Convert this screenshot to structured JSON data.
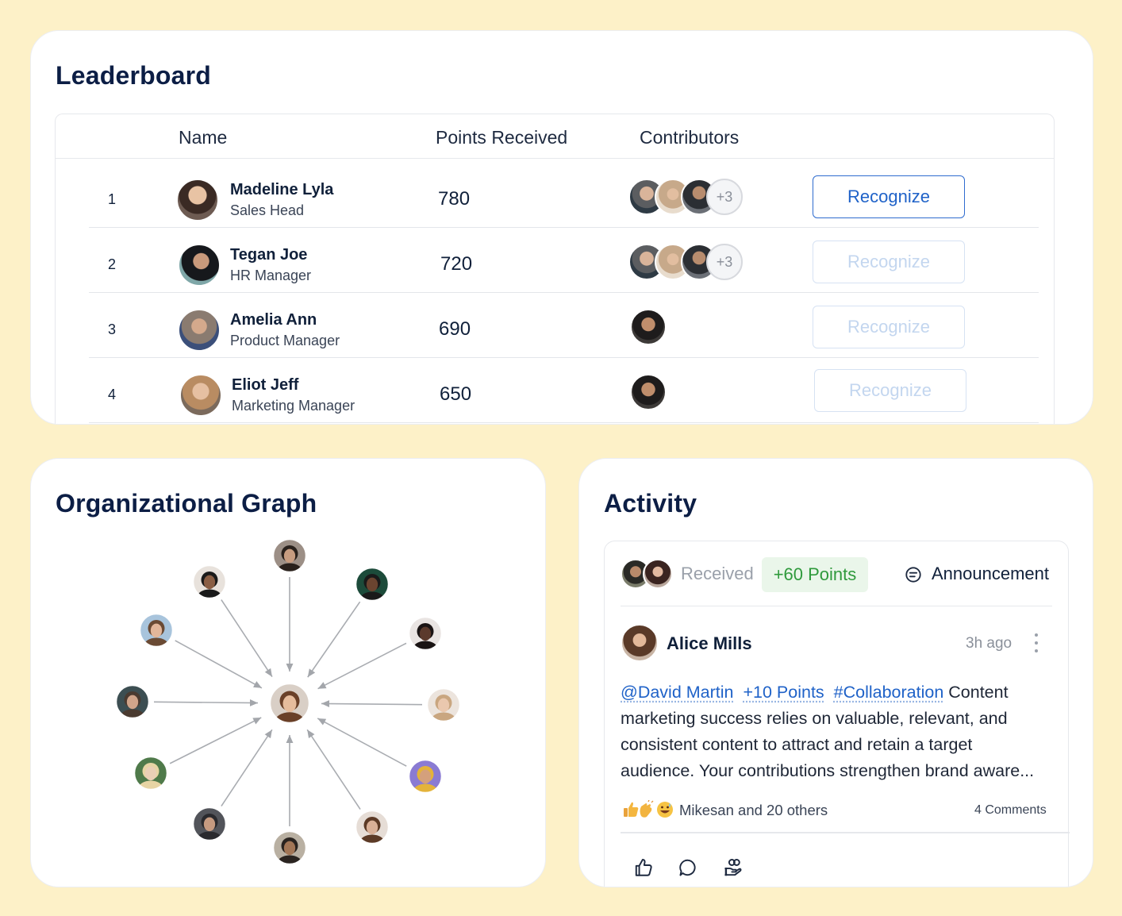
{
  "colors": {
    "page_background": "#fdf1c8",
    "title": "#0c1e45",
    "accent_blue": "#1f62c8",
    "points_green": "#2f9a3c"
  },
  "leaderboard": {
    "title": "Leaderboard",
    "columns": {
      "name": "Name",
      "points": "Points Received",
      "contributors": "Contributors"
    },
    "rows": [
      {
        "rank": "1",
        "name": "Madeline Lyla",
        "role": "Sales Head",
        "points": "780",
        "extra_contributors": "+3",
        "button": "Recognize",
        "button_state": "active"
      },
      {
        "rank": "2",
        "name": "Tegan Joe",
        "role": "HR Manager",
        "points": "720",
        "extra_contributors": "+3",
        "button": "Recognize",
        "button_state": "muted"
      },
      {
        "rank": "3",
        "name": "Amelia Ann",
        "role": "Product Manager",
        "points": "690",
        "extra_contributors": "",
        "button": "Recognize",
        "button_state": "muted"
      },
      {
        "rank": "4",
        "name": "Eliot Jeff",
        "role": "Marketing Manager",
        "points": "650",
        "extra_contributors": "",
        "button": "Recognize",
        "button_state": "muted"
      }
    ]
  },
  "org_graph": {
    "title": "Organizational Graph"
  },
  "activity": {
    "title": "Activity",
    "received_label": "Received",
    "points_badge": "+60 Points",
    "announcement_label": "Announcement",
    "post": {
      "author": "Alice Mills",
      "time": "3h ago",
      "mention": "@David Martin",
      "points_tag": "+10 Points",
      "hashtag": "#Collaboration",
      "body": "Content marketing success relies on valuable, relevant, and consistent content to attract and retain a target audience. Your contributions strengthen brand aware...",
      "reactions": "Mikesan and 20 others",
      "comments": "4 Comments"
    },
    "icons": [
      "thumbs-up-icon",
      "comment-icon",
      "gift-icon"
    ]
  }
}
